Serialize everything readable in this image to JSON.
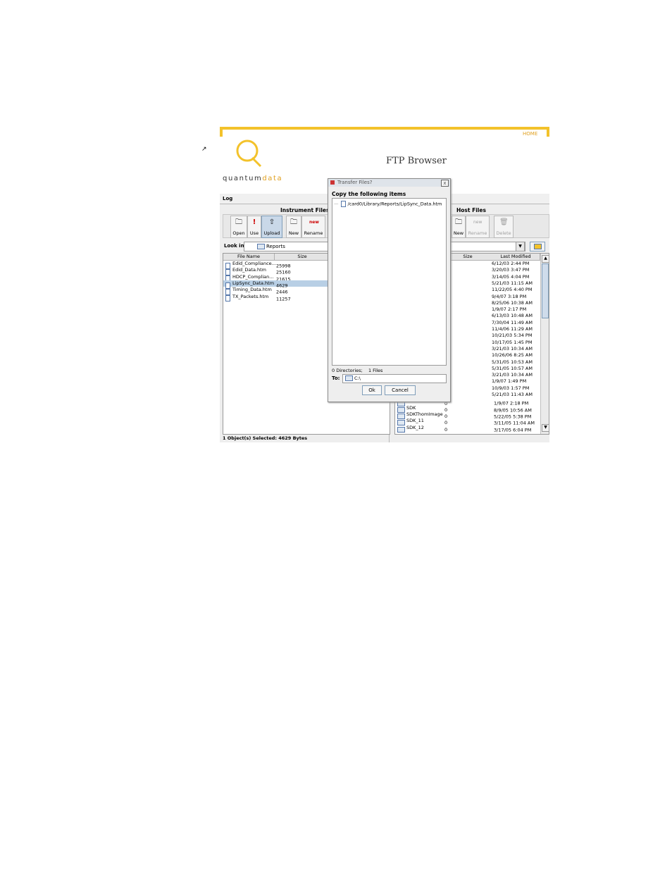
{
  "page": {
    "cursor_glyph": "↗",
    "header": {
      "home_link": "HOME",
      "title": "FTP Browser",
      "logo_quantum": "quantum",
      "logo_data": "data"
    },
    "menu": {
      "log": "Log"
    },
    "instrument": {
      "title": "Instrument Files",
      "toolbar": {
        "open": "Open",
        "use": "Use",
        "upload": "Upload",
        "new": "New",
        "rename": "Rename"
      },
      "look_in_label": "Look in:",
      "look_in_value": "Reports",
      "columns": {
        "name": "File Name",
        "size": "Size"
      },
      "rows": [
        {
          "name": "Edid_Compliance...",
          "size": "25998",
          "selected": false
        },
        {
          "name": "Edid_Data.htm",
          "size": "25160",
          "selected": false
        },
        {
          "name": "HDCP_Complian...",
          "size": "21615",
          "selected": false
        },
        {
          "name": "LipSync_Data.htm",
          "size": "4629",
          "selected": true
        },
        {
          "name": "Timing_Data.htm",
          "size": "2446",
          "selected": false
        },
        {
          "name": "TX_Packets.htm",
          "size": "11257",
          "selected": false
        }
      ],
      "status": "1 Object(s) Selected: 4629 Bytes"
    },
    "host": {
      "title": "Host Files",
      "toolbar": {
        "new": "New",
        "rename": "Rename",
        "delete": "Delete"
      },
      "columns": {
        "size": "Size",
        "modified": "Last Modified"
      },
      "modified_only": [
        "6/12/03 2:44 PM",
        "3/20/03 3:47 PM",
        "3/14/05 4:04 PM",
        "5/21/03 11:15 AM",
        "11/22/05 4:40 PM",
        "9/4/07 3:18 PM",
        "8/25/06 10:38 AM",
        "1/9/07 2:17 PM",
        "6/13/03 10:48 AM",
        "7/30/04 11:49 AM",
        "11/4/06 11:29 AM",
        "10/21/03 5:34 PM",
        "10/17/05 1:45 PM",
        "3/21/03 10:34 AM",
        "10/26/06 8:25 AM",
        "5/31/05 10:53 AM",
        "5/31/05 10:57 AM",
        "3/21/03 10:34 AM",
        "1/9/07 1:49 PM",
        "10/9/03 1:57 PM",
        "5/21/03 11:43 AM"
      ],
      "rows": [
        {
          "name": "RECYCLER",
          "size": "0",
          "modified": "1/9/07 2:18 PM"
        },
        {
          "name": "SDK",
          "size": "0",
          "modified": "8/9/05 10:56 AM"
        },
        {
          "name": "SDKThomImage",
          "size": "0",
          "modified": "5/22/05 5:38 PM"
        },
        {
          "name": "SDK_11",
          "size": "0",
          "modified": "3/11/05 11:04 AM"
        },
        {
          "name": "SDK_12",
          "size": "0",
          "modified": "3/17/05 6:04 PM"
        }
      ]
    },
    "dialog": {
      "title": "Transfer Files?",
      "close": "x",
      "heading": "Copy the following items",
      "item": "/card0/Library/Reports/LipSync_Data.htm",
      "summary_dirs": "0 Directories;",
      "summary_files": "1 Files",
      "to_label": "To:",
      "to_value": "C:\\",
      "ok": "Ok",
      "cancel": "Cancel"
    }
  }
}
